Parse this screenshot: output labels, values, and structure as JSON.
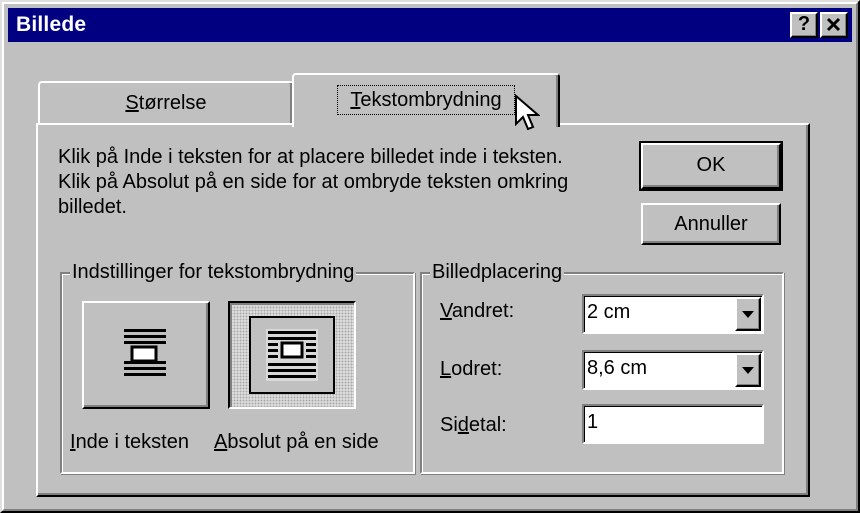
{
  "window": {
    "title": "Billede",
    "help_label": "?",
    "close_label": "✕"
  },
  "tabs": [
    {
      "underlined": "S",
      "rest": "tørrelse",
      "selected": false
    },
    {
      "underlined": "T",
      "rest": "ekstombrydning",
      "selected": true
    }
  ],
  "description": "Klik på Inde i teksten for at placere billedet inde i teksten. Klik på Absolut på en side for at ombryde teksten omkring billedet.",
  "buttons": {
    "ok_label": "OK",
    "cancel_label": "Annuller"
  },
  "wrap_group": {
    "title": "Indstillinger for tekstombrydning",
    "options": [
      {
        "underlined": "I",
        "rest": "nde i teksten",
        "icon": "inline-wrap-icon",
        "selected": false
      },
      {
        "underlined": "A",
        "rest": "bsolut på en side",
        "icon": "absolute-wrap-icon",
        "selected": true
      }
    ]
  },
  "position_group": {
    "title": "Billedplacering",
    "horizontal": {
      "underlined": "V",
      "rest": "andret:",
      "value": "2 cm"
    },
    "vertical": {
      "underlined": "L",
      "rest": "odret:",
      "value": "8,6 cm"
    },
    "page": {
      "before": "Si",
      "underlined": "d",
      "rest": "etal:",
      "value": "1"
    }
  },
  "colors": {
    "titlebar": "#000080",
    "face": "#c0c0c0"
  }
}
